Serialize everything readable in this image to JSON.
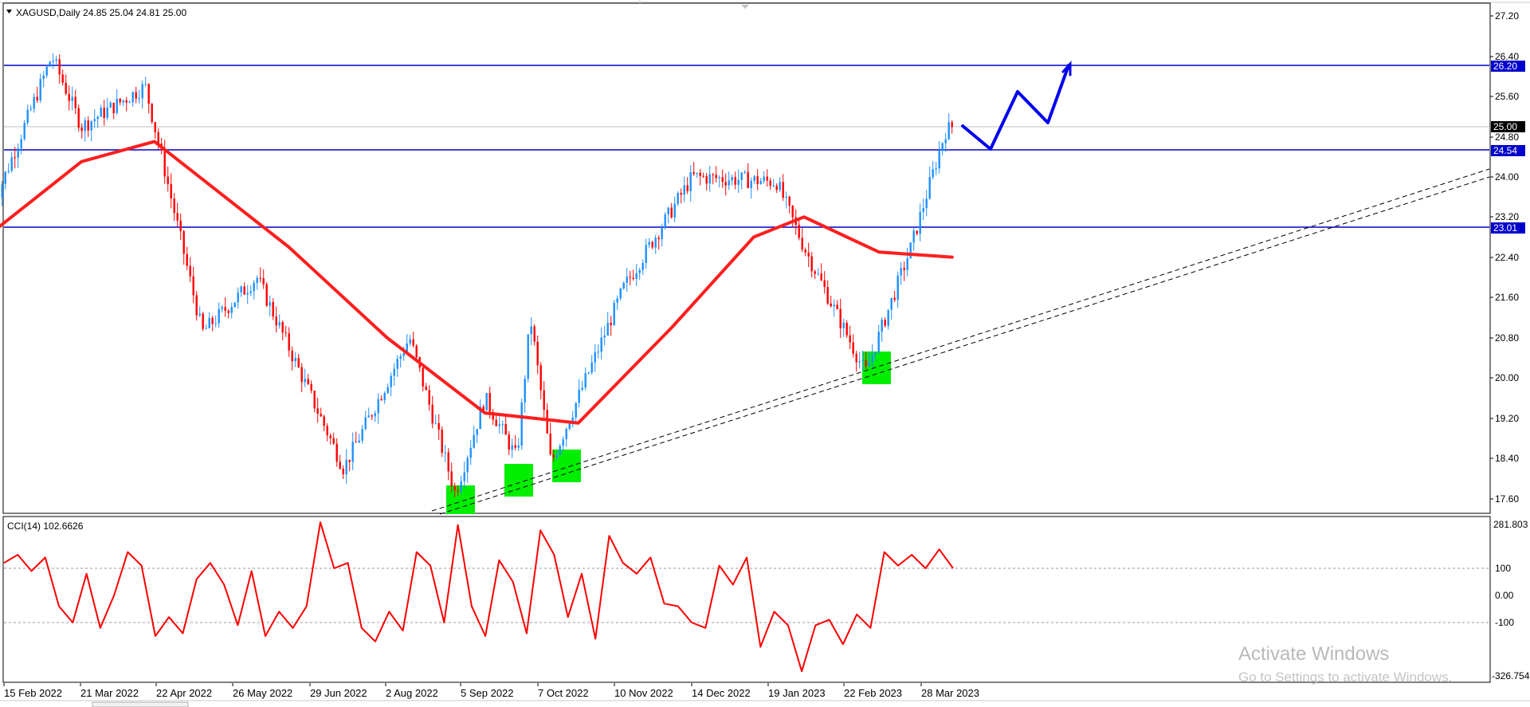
{
  "header": {
    "symbol_line": "XAGUSD,Daily  24.85 25.04 24.81 25.00"
  },
  "indicator": {
    "label": "CCI(14) 102.6626",
    "scale_labels": [
      "281.803",
      "100",
      "0.00",
      "-100",
      "-326.754"
    ]
  },
  "price_axis": {
    "labels": [
      "27.20",
      "26.40",
      "25.60",
      "24.80",
      "24.00",
      "23.20",
      "22.40",
      "21.60",
      "20.80",
      "20.00",
      "19.20",
      "18.40",
      "17.60"
    ]
  },
  "price_tags": {
    "resistance_high": "26.20",
    "current": "25.00",
    "resistance_mid": "24.54",
    "support": "23.01"
  },
  "time_axis": {
    "labels": [
      "15 Feb 2022",
      "21 Mar 2022",
      "22 Apr 2022",
      "26 May 2022",
      "29 Jun 2022",
      "2 Aug 2022",
      "5 Sep 2022",
      "7 Oct 2022",
      "10 Nov 2022",
      "14 Dec 2022",
      "19 Jan 2023",
      "22 Feb 2023",
      "28 Mar 2023"
    ]
  },
  "watermark": {
    "title": "Activate Windows",
    "subtitle": "Go to Settings to activate Windows."
  },
  "colors": {
    "bull": "#1e90ff",
    "bear": "#ff0000",
    "ma": "#ff1e1e",
    "hline": "#0000cd",
    "tag_current": "#000000",
    "zone": "#00ee00",
    "cci": "#ff0000"
  },
  "chart_data": {
    "type": "candlestick",
    "title": "XAGUSD,Daily",
    "ylim": [
      17.3,
      27.35
    ],
    "horizontal_levels": [
      26.2,
      24.54,
      23.01
    ],
    "current_price": 25.0,
    "ohlc_last": {
      "open": 24.85,
      "high": 25.04,
      "low": 24.81,
      "close": 25.0
    },
    "price_path_approx": [
      {
        "date": "2022-02-10",
        "close": 23.4
      },
      {
        "date": "2022-03-08",
        "close": 26.4
      },
      {
        "date": "2022-03-21",
        "close": 25.0
      },
      {
        "date": "2022-04-18",
        "close": 25.8
      },
      {
        "date": "2022-05-13",
        "close": 20.9
      },
      {
        "date": "2022-06-06",
        "close": 22.0
      },
      {
        "date": "2022-07-14",
        "close": 18.2
      },
      {
        "date": "2022-08-12",
        "close": 20.8
      },
      {
        "date": "2022-09-01",
        "close": 17.7
      },
      {
        "date": "2022-09-14",
        "close": 19.6
      },
      {
        "date": "2022-09-28",
        "close": 18.4
      },
      {
        "date": "2022-10-04",
        "close": 21.2
      },
      {
        "date": "2022-10-13",
        "close": 18.3
      },
      {
        "date": "2022-11-14",
        "close": 21.8
      },
      {
        "date": "2022-12-14",
        "close": 24.0
      },
      {
        "date": "2023-01-20",
        "close": 23.9
      },
      {
        "date": "2023-02-01",
        "close": 22.6
      },
      {
        "date": "2023-02-28",
        "close": 20.1
      },
      {
        "date": "2023-03-20",
        "close": 22.6
      },
      {
        "date": "2023-04-04",
        "close": 24.9
      },
      {
        "date": "2023-04-07",
        "close": 25.0
      }
    ],
    "moving_average_path_approx": [
      {
        "date": "2022-02-10",
        "value": 22.9
      },
      {
        "date": "2022-03-21",
        "value": 24.3
      },
      {
        "date": "2022-04-22",
        "value": 24.7
      },
      {
        "date": "2022-06-20",
        "value": 22.6
      },
      {
        "date": "2022-08-02",
        "value": 20.8
      },
      {
        "date": "2022-09-14",
        "value": 19.3
      },
      {
        "date": "2022-10-25",
        "value": 19.1
      },
      {
        "date": "2022-12-05",
        "value": 21.0
      },
      {
        "date": "2023-01-10",
        "value": 22.8
      },
      {
        "date": "2023-02-01",
        "value": 23.2
      },
      {
        "date": "2023-03-06",
        "value": 22.5
      },
      {
        "date": "2023-04-07",
        "value": 22.4
      }
    ],
    "trendline": {
      "from": {
        "date": "2022-09-01",
        "value": 17.45
      },
      "to": {
        "date": "2023-05-25",
        "value": 24.1
      }
    },
    "demand_zones": [
      {
        "date": "2022-09-01",
        "low": 17.3,
        "high": 17.9
      },
      {
        "date": "2022-09-30",
        "low": 17.9,
        "high": 18.5
      },
      {
        "date": "2022-10-17",
        "low": 18.2,
        "high": 18.8
      },
      {
        "date": "2023-03-09",
        "low": 19.9,
        "high": 20.5
      }
    ],
    "projection_path": [
      {
        "date": "2023-04-10",
        "value": 25.0
      },
      {
        "date": "2023-04-19",
        "value": 24.55
      },
      {
        "date": "2023-04-27",
        "value": 25.7
      },
      {
        "date": "2023-05-10",
        "value": 25.1
      },
      {
        "date": "2023-05-17",
        "value": 26.2
      }
    ],
    "cci": {
      "name": "CCI(14)",
      "ylim": [
        -326.754,
        281.803
      ],
      "levels": [
        100,
        0,
        -100
      ],
      "values_approx": [
        120,
        150,
        90,
        140,
        -40,
        -100,
        80,
        -120,
        0,
        160,
        110,
        -150,
        -80,
        -140,
        60,
        120,
        40,
        -110,
        90,
        -150,
        -60,
        -120,
        -40,
        270,
        100,
        120,
        -120,
        -170,
        -60,
        -130,
        160,
        110,
        -100,
        260,
        -40,
        -150,
        130,
        50,
        -140,
        240,
        150,
        -80,
        80,
        -160,
        220,
        120,
        80,
        140,
        -30,
        -40,
        -100,
        -120,
        110,
        40,
        140,
        -190,
        -60,
        -110,
        -280,
        -110,
        -90,
        -180,
        -70,
        -120,
        160,
        110,
        150,
        100,
        170,
        100
      ]
    }
  }
}
